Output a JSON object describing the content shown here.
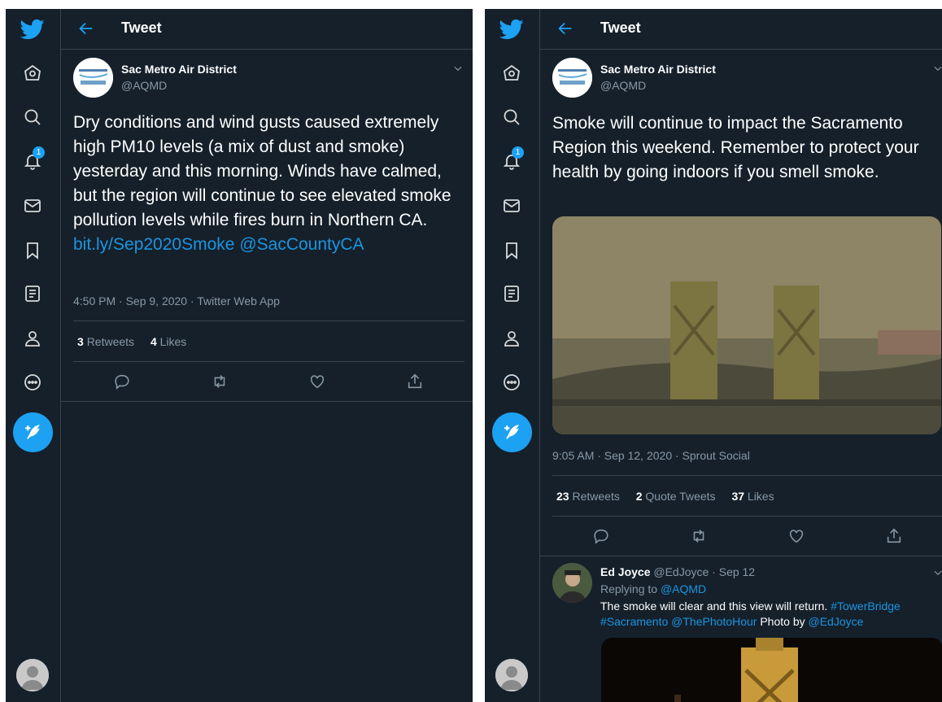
{
  "left": {
    "header_title": "Tweet",
    "account": {
      "name": "Sac Metro Air District",
      "handle": "@AQMD"
    },
    "tweet": {
      "text": "Dry conditions and wind gusts caused extremely high PM10 levels (a mix of dust and smoke) yesterday and this morning. Winds have calmed, but the region will continue to see elevated smoke pollution levels while fires burn in Northern CA.",
      "link": "bit.ly/Sep2020Smoke",
      "mention": "@SacCountyCA",
      "meta": "4:50 PM · Sep 9, 2020 · Twitter Web App"
    },
    "stats": {
      "retweets_count": "3",
      "retweets_label": "Retweets",
      "likes_count": "4",
      "likes_label": "Likes"
    },
    "notification_badge": "1"
  },
  "right": {
    "header_title": "Tweet",
    "account": {
      "name": "Sac Metro Air District",
      "handle": "@AQMD"
    },
    "tweet": {
      "text": "Smoke will continue to impact the Sacramento Region this weekend. Remember to protect your health by going indoors if you smell smoke.",
      "meta": "9:05 AM · Sep 12, 2020 · Sprout Social"
    },
    "stats": {
      "retweets_count": "23",
      "retweets_label": "Retweets",
      "quotes_count": "2",
      "quotes_label": "Quote Tweets",
      "likes_count": "37",
      "likes_label": "Likes"
    },
    "notification_badge": "1",
    "reply": {
      "name": "Ed Joyce",
      "handle_date": "@EdJoyce · Sep 12",
      "replying_label": "Replying to",
      "replying_to": "@AQMD",
      "text_main": "The smoke will clear and this view will return.",
      "tag1": "#TowerBridge",
      "tag2": "#Sacramento",
      "mention": "@ThePhotoHour",
      "photo_by": "Photo by",
      "credit": "@EdJoyce"
    }
  },
  "colors": {
    "background": "#15202b",
    "accent": "#1da1f2",
    "link": "#1b95e0",
    "muted": "#8899a6",
    "border": "#38444d"
  },
  "icons": [
    "twitter-bird-icon",
    "home-icon",
    "explore-icon",
    "notifications-icon",
    "messages-icon",
    "bookmarks-icon",
    "lists-icon",
    "profile-icon",
    "more-icon",
    "compose-icon",
    "back-arrow-icon",
    "chevron-down-icon",
    "reply-icon",
    "retweet-icon",
    "like-icon",
    "share-icon"
  ]
}
